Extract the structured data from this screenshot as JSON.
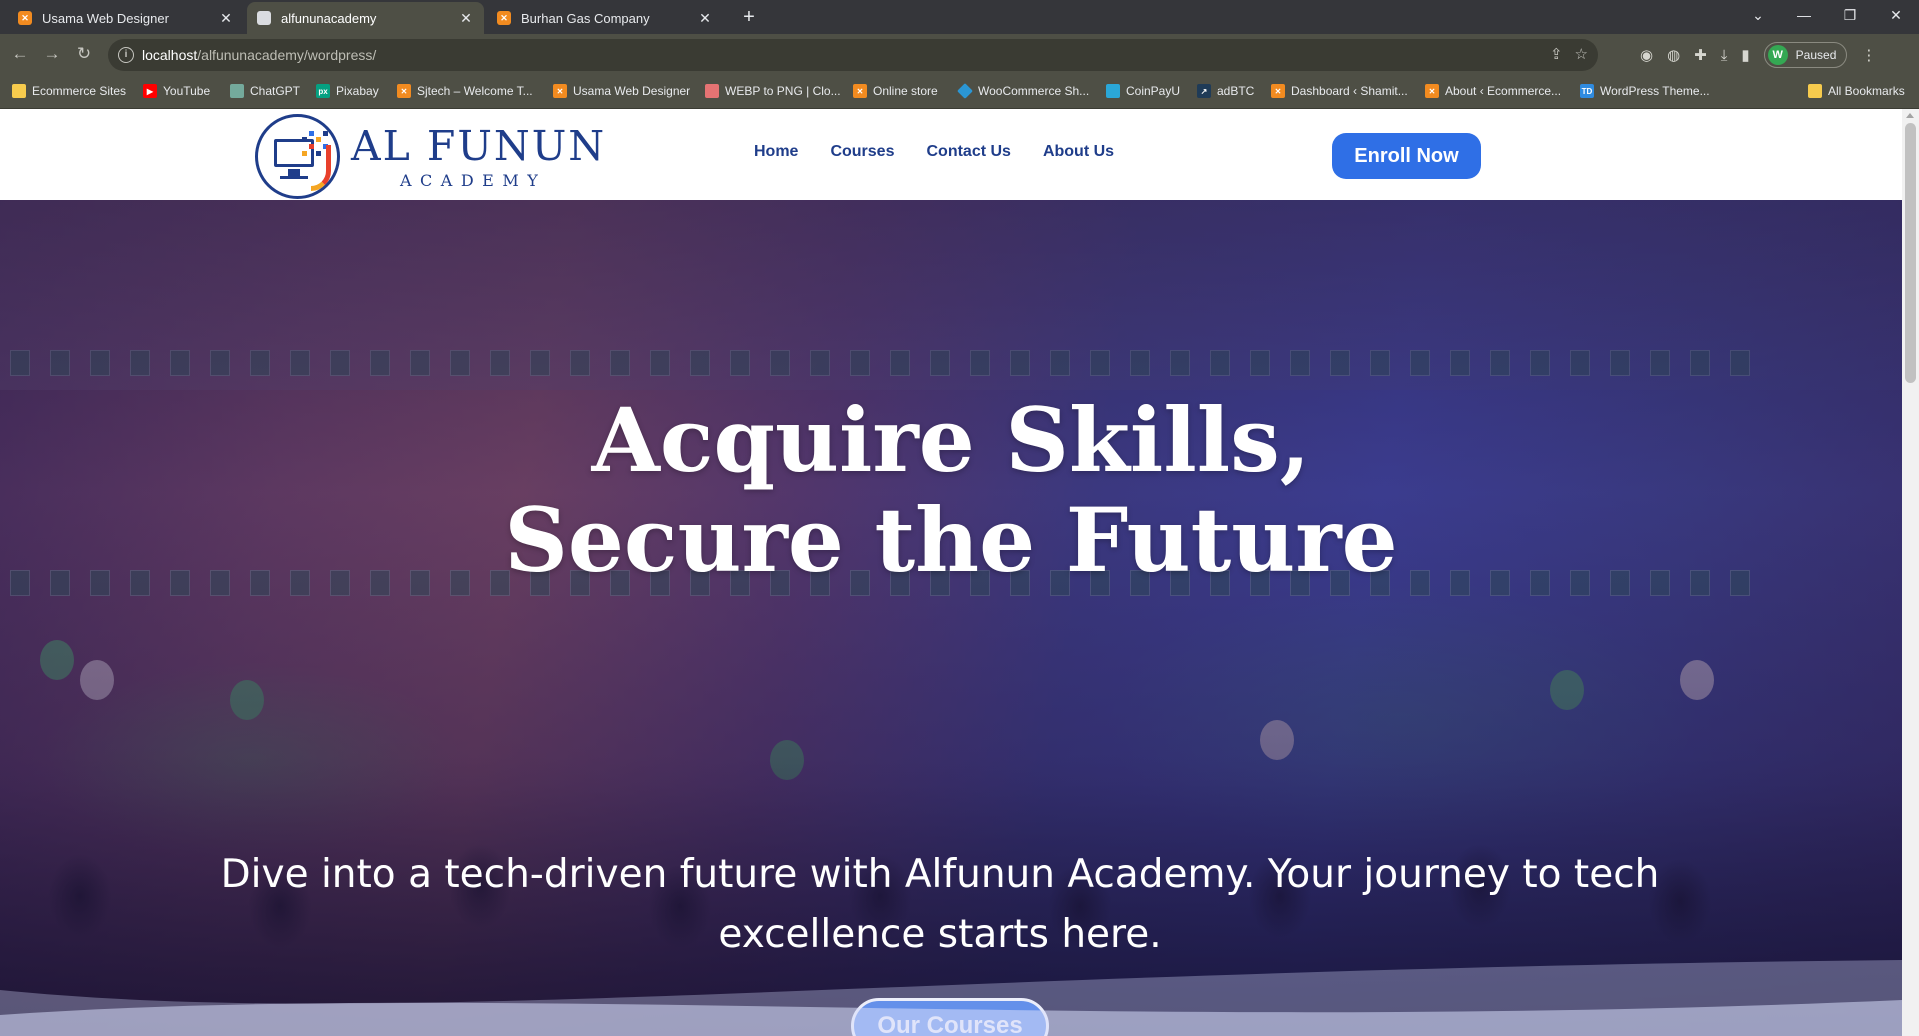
{
  "browser": {
    "tabs": [
      {
        "title": "Usama Web Designer",
        "active": false,
        "icon": "xampp-icon"
      },
      {
        "title": "alfununacademy",
        "active": true,
        "icon": "page-icon"
      },
      {
        "title": "Burhan Gas Company",
        "active": false,
        "icon": "xampp-icon"
      }
    ],
    "url_host": "localhost",
    "url_path": "/alfununacademy/wordpress/",
    "profile_initial": "W",
    "profile_status": "Paused",
    "bookmarks": [
      {
        "label": "Ecommerce Sites",
        "icon": "folder-icon"
      },
      {
        "label": "YouTube",
        "icon": "youtube-icon"
      },
      {
        "label": "ChatGPT",
        "icon": "chatgpt-icon"
      },
      {
        "label": "Pixabay",
        "icon": "pixabay-icon"
      },
      {
        "label": "Sjtech – Welcome T...",
        "icon": "xampp-icon"
      },
      {
        "label": "Usama Web Designer",
        "icon": "xampp-icon"
      },
      {
        "label": "WEBP to PNG | Clo...",
        "icon": "cloud-icon"
      },
      {
        "label": "Online store",
        "icon": "xampp-icon"
      },
      {
        "label": "WooCommerce Sh...",
        "icon": "woocommerce-icon"
      },
      {
        "label": "CoinPayU",
        "icon": "coinpayu-icon"
      },
      {
        "label": "adBTC",
        "icon": "adbtc-icon"
      },
      {
        "label": "Dashboard ‹ Shamit...",
        "icon": "xampp-icon"
      },
      {
        "label": "About ‹ Ecommerce...",
        "icon": "xampp-icon"
      },
      {
        "label": "WordPress Theme...",
        "icon": "td-icon"
      }
    ],
    "all_bookmarks": "All Bookmarks"
  },
  "site": {
    "logo_title": "AL FUNUN",
    "logo_subtitle": "ACADEMY",
    "nav": [
      "Home",
      "Courses",
      "Contact Us",
      "About Us"
    ],
    "enroll_label": "Enroll Now",
    "hero_title_line1": "Acquire Skills,",
    "hero_title_line2": "Secure the Future",
    "hero_subtitle": "Dive into a tech-driven future with Alfunun Academy. Your journey to tech excellence starts here.",
    "courses_button": "Our Courses"
  },
  "colors": {
    "brand_navy": "#1f3d8a",
    "button_blue": "#2f6fe6",
    "browser_frame": "#4e4f45"
  }
}
